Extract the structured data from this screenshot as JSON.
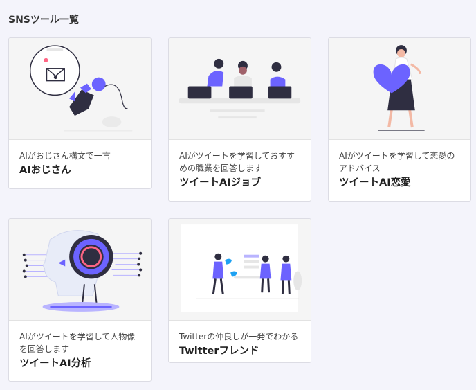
{
  "page": {
    "title": "SNSツール一覧"
  },
  "cards": [
    {
      "description": "AIがおじさん構文で一言",
      "name": "AIおじさん",
      "icon": "robot-envelope-illustration"
    },
    {
      "description": "AIがツイートを学習しておすすめの職業を回答します",
      "name": "ツイートAIジョブ",
      "icon": "team-laptops-illustration"
    },
    {
      "description": "AIがツイートを学習して恋愛のアドバイス",
      "name": "ツイートAI恋愛",
      "icon": "woman-heart-illustration"
    },
    {
      "description": "AIがツイートを学習して人物像を回答します",
      "name": "ツイートAI分析",
      "icon": "ai-head-illustration"
    },
    {
      "description": "Twitterの仲良しが一発でわかる",
      "name": "Twitterフレンド",
      "icon": "twitter-friends-illustration"
    }
  ],
  "colors": {
    "accent": "#6c63ff",
    "background": "#f4f4fb",
    "dark": "#2f2e41"
  }
}
